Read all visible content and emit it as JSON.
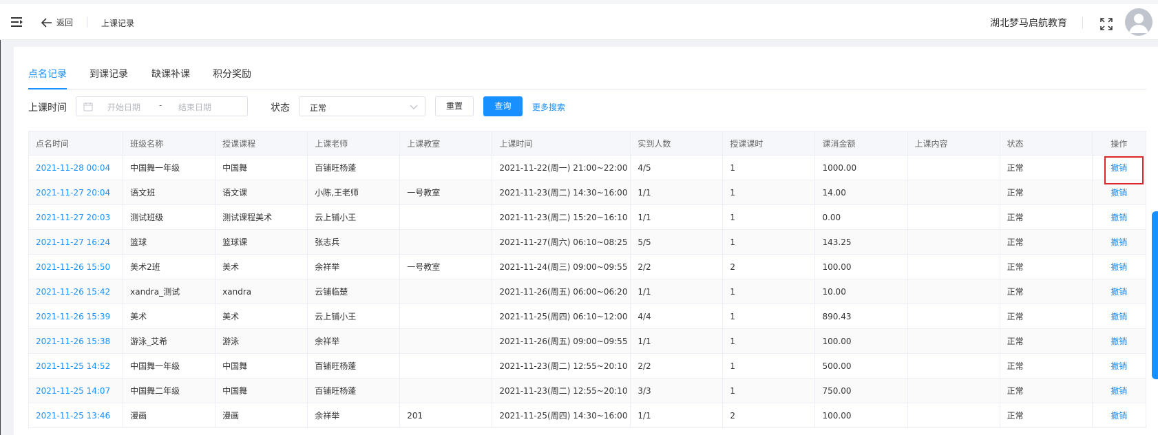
{
  "header": {
    "back_label": "返回",
    "crumb": "上课记录",
    "org_name": "湖北梦马启航教育"
  },
  "tabs": [
    {
      "label": "点名记录",
      "active": true
    },
    {
      "label": "到课记录",
      "active": false
    },
    {
      "label": "缺课补课",
      "active": false
    },
    {
      "label": "积分奖励",
      "active": false
    }
  ],
  "filter": {
    "time_label": "上课时间",
    "start_placeholder": "开始日期",
    "dash": "-",
    "end_placeholder": "结束日期",
    "status_label": "状态",
    "status_value": "正常",
    "reset_label": "重置",
    "query_label": "查询",
    "more_label": "更多搜索"
  },
  "table": {
    "headers": [
      "点名时间",
      "班级名称",
      "授课课程",
      "上课老师",
      "上课教室",
      "上课时间",
      "实到人数",
      "授课课时",
      "课消金额",
      "上课内容",
      "状态",
      "操作"
    ],
    "rows": [
      [
        "2021-11-28 00:04",
        "中国舞一年级",
        "中国舞",
        "百铺旺杨蓬",
        "",
        "2021-11-22(周一) 21:00~22:00",
        "4/5",
        "1",
        "1000.00",
        "",
        "正常",
        "撤销"
      ],
      [
        "2021-11-27 20:04",
        "语文班",
        "语文课",
        "小陈,王老师",
        "一号教室",
        "2021-11-23(周二) 14:30~16:00",
        "1/1",
        "1",
        "14.00",
        "",
        "正常",
        "撤销"
      ],
      [
        "2021-11-27 20:03",
        "测试班级",
        "测试课程美术",
        "云上铺小王",
        "",
        "2021-11-23(周二) 15:20~16:10",
        "1/1",
        "1",
        "0.00",
        "",
        "正常",
        "撤销"
      ],
      [
        "2021-11-27 16:24",
        "篮球",
        "篮球课",
        "张志兵",
        "",
        "2021-11-27(周六) 06:10~08:25",
        "5/5",
        "1",
        "143.25",
        "",
        "正常",
        "撤销"
      ],
      [
        "2021-11-26 15:50",
        "美术2班",
        "美术",
        "余祥举",
        "一号教室",
        "2021-11-24(周三) 09:00~09:55",
        "2/2",
        "2",
        "100.00",
        "",
        "正常",
        "撤销"
      ],
      [
        "2021-11-26 15:42",
        "xandra_测试",
        "xandra",
        "云铺临楚",
        "",
        "2021-11-26(周五) 06:00~06:20",
        "1/1",
        "1",
        "10.00",
        "",
        "正常",
        "撤销"
      ],
      [
        "2021-11-26 15:39",
        "美术",
        "美术",
        "云上铺小王",
        "",
        "2021-11-25(周四) 06:10~12:00",
        "4/4",
        "1",
        "890.43",
        "",
        "正常",
        "撤销"
      ],
      [
        "2021-11-26 15:38",
        "游泳_艾希",
        "游泳",
        "余祥举",
        "",
        "2021-11-26(周五) 09:00~09:55",
        "1/1",
        "1",
        "100.00",
        "",
        "正常",
        "撤销"
      ],
      [
        "2021-11-25 14:52",
        "中国舞一年级",
        "中国舞",
        "百铺旺杨蓬",
        "",
        "2021-11-23(周二) 12:55~20:10",
        "2/2",
        "1",
        "500.00",
        "",
        "正常",
        "撤销"
      ],
      [
        "2021-11-25 14:07",
        "中国舞二年级",
        "中国舞",
        "百铺旺杨蓬",
        "",
        "2021-11-23(周二) 12:55~20:10",
        "3/3",
        "1",
        "750.00",
        "",
        "正常",
        "撤销"
      ],
      [
        "2021-11-25 13:46",
        "漫画",
        "漫画",
        "余祥举",
        "201",
        "2021-11-25(周四) 14:30~16:00",
        "1/1",
        "2",
        "100.00",
        "",
        "正常",
        "撤销"
      ]
    ]
  },
  "colors": {
    "accent": "#1890ff",
    "highlight": "#e0242b"
  },
  "icons": [
    "menu-fold-icon",
    "arrow-left-icon",
    "calendar-icon",
    "chevron-down-icon",
    "fullscreen-icon",
    "avatar-user-icon"
  ]
}
